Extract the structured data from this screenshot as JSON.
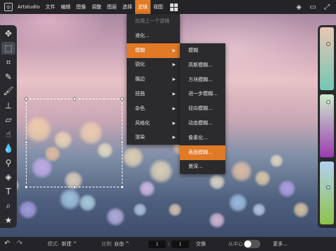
{
  "app": {
    "name": "Artstudio"
  },
  "menubar": {
    "items": [
      {
        "label": "文件"
      },
      {
        "label": "编辑"
      },
      {
        "label": "图像"
      },
      {
        "label": "调整"
      },
      {
        "label": "图层"
      },
      {
        "label": "选择"
      },
      {
        "label": "滤镜",
        "active": true
      },
      {
        "label": "视图"
      }
    ]
  },
  "filter_menu": {
    "items": [
      {
        "label": "应用上一个滤镜",
        "disabled": true
      },
      {
        "label": "液化..."
      },
      {
        "label": "模糊",
        "active": true,
        "submenu": true
      },
      {
        "label": "锐化",
        "submenu": true
      },
      {
        "label": "描边",
        "submenu": true
      },
      {
        "label": "扭曲",
        "submenu": true
      },
      {
        "label": "杂色",
        "submenu": true
      },
      {
        "label": "风格化",
        "submenu": true
      },
      {
        "label": "渲染",
        "submenu": true
      }
    ]
  },
  "blur_submenu": {
    "items": [
      {
        "label": "模糊"
      },
      {
        "label": "高斯模糊..."
      },
      {
        "label": "方块模糊..."
      },
      {
        "label": "进一步模糊..."
      },
      {
        "label": "径向模糊..."
      },
      {
        "label": "动态模糊..."
      },
      {
        "label": "像素化..."
      },
      {
        "label": "表面模糊...",
        "active": true
      },
      {
        "label": "景深..."
      }
    ]
  },
  "tools": [
    {
      "name": "move-tool",
      "glyph": "✥"
    },
    {
      "name": "marquee-tool",
      "glyph": "⬚",
      "selected": true
    },
    {
      "name": "crop-tool",
      "glyph": "⌗"
    },
    {
      "name": "eyedropper-tool",
      "glyph": "✎"
    },
    {
      "name": "brush-tool",
      "glyph": "🖌"
    },
    {
      "name": "stamp-tool",
      "glyph": "⊥"
    },
    {
      "name": "eraser-tool",
      "glyph": "▱"
    },
    {
      "name": "smudge-tool",
      "glyph": "☝"
    },
    {
      "name": "blur-tool",
      "glyph": "💧"
    },
    {
      "name": "dodge-tool",
      "glyph": "⚲"
    },
    {
      "name": "fill-tool",
      "glyph": "◈"
    },
    {
      "name": "text-tool",
      "glyph": "T"
    },
    {
      "name": "zoom-tool",
      "glyph": "⌕"
    },
    {
      "name": "favorites-tool",
      "glyph": "★"
    }
  ],
  "colors": {
    "accent": "#e07a26",
    "swatch_top": [
      "#e8c7b4",
      "#72c7b3"
    ],
    "swatch_mid": [
      "#cdeccc",
      "#9a3bb0"
    ],
    "swatch_bottom": [
      "#b3d1ef",
      "#8dc34a"
    ],
    "slider_levels": [
      0.25,
      0.1,
      0.4
    ]
  },
  "bottombar": {
    "mode_label": "模式:",
    "mode_value": "新建",
    "ratio_label": "比例",
    "ratio_value": "自由",
    "width_value": "1",
    "separator": ":",
    "height_value": "1",
    "swap_label": "交换",
    "from_center_label": "从中心",
    "more_label": "更多..."
  }
}
